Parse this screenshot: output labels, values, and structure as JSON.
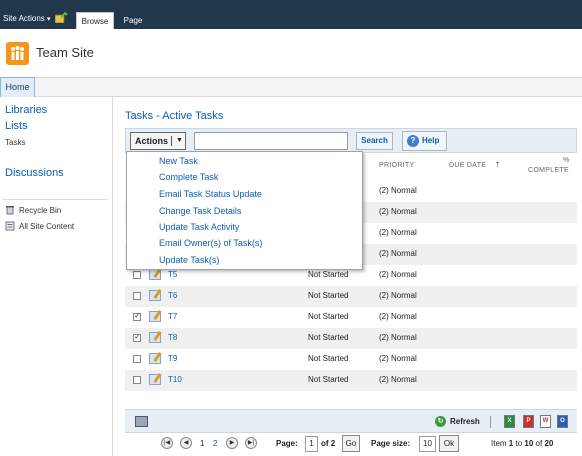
{
  "ribbon": {
    "site_actions": "Site Actions",
    "tabs": [
      "Browse",
      "Page"
    ],
    "colors": {
      "background": "#21374c"
    }
  },
  "header": {
    "site_title": "Team Site",
    "logo_icon": "team-site-logo"
  },
  "topnav": {
    "home": "Home"
  },
  "quicklaunch": {
    "libraries": "Libraries",
    "lists": "Lists",
    "tasks": "Tasks",
    "discussions": "Discussions",
    "recycle_bin": "Recycle Bin",
    "all_site_content": "All Site Content"
  },
  "page": {
    "title": "Tasks - Active Tasks"
  },
  "toolbar": {
    "actions_label": "Actions",
    "search_value": "",
    "search_label": "Search",
    "help_label": "Help"
  },
  "columns": {
    "priority": "PRIORITY",
    "due_date": "DUE DATE",
    "sort_arrow": "↑",
    "pct": "%",
    "complete": "COMPLETE"
  },
  "actions_menu": [
    "New Task",
    "Complete Task",
    "Email Task Status Update",
    "Change Task Details",
    "Update Task Activity",
    "Email Owner(s) of Task(s)",
    "Update Task(s)"
  ],
  "rows": [
    {
      "title": "",
      "status": "",
      "priority": "(2) Normal",
      "checked": false
    },
    {
      "title": "",
      "status": "",
      "priority": "(2) Normal",
      "checked": false
    },
    {
      "title": "",
      "status": "",
      "priority": "(2) Normal",
      "checked": false
    },
    {
      "title": "",
      "status": "",
      "priority": "(2) Normal",
      "checked": false
    },
    {
      "title": "T5",
      "status": "Not Started",
      "priority": "(2) Normal",
      "checked": false
    },
    {
      "title": "T6",
      "status": "Not Started",
      "priority": "(2) Normal",
      "checked": false
    },
    {
      "title": "T7",
      "status": "Not Started",
      "priority": "(2) Normal",
      "checked": true
    },
    {
      "title": "T8",
      "status": "Not Started",
      "priority": "(2) Normal",
      "checked": true
    },
    {
      "title": "T9",
      "status": "Not Started",
      "priority": "(2) Normal",
      "checked": false
    },
    {
      "title": "T10",
      "status": "Not Started",
      "priority": "(2) Normal",
      "checked": false
    }
  ],
  "footer": {
    "refresh": "Refresh",
    "export_icons": [
      "excel-icon",
      "pdf-icon",
      "word-icon",
      "outlook-icon"
    ]
  },
  "pager": {
    "page_current": "1",
    "page_next": "2",
    "page_label": "Page:",
    "page_value": "1",
    "of_label": "of 2",
    "go": "Go",
    "page_size_label": "Page size:",
    "page_size_value": "10",
    "ok": "Ok",
    "item_label": "Item",
    "item_from": "1",
    "to_label": "to",
    "item_to": "10",
    "of_total_label": "of",
    "item_total": "20"
  }
}
